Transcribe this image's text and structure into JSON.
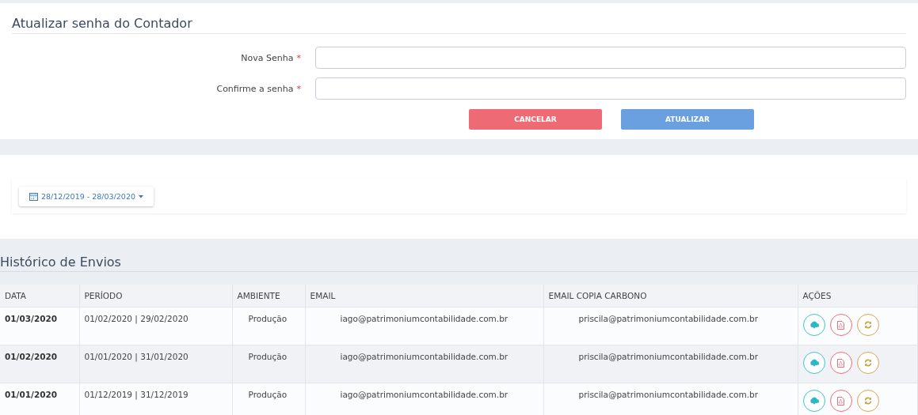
{
  "form": {
    "title": "Atualizar senha do Contador",
    "fields": [
      {
        "label": "Nova Senha",
        "required_mark": "*"
      },
      {
        "label": "Confirme a senha",
        "required_mark": "*"
      }
    ],
    "buttons": [
      {
        "label": "CANCELAR",
        "kind": "cancel"
      },
      {
        "label": "ATUALIZAR",
        "kind": "submit"
      }
    ]
  },
  "date_range": {
    "label": "28/12/2019 - 28/03/2020"
  },
  "history": {
    "title": "Histórico de Envios",
    "columns": [
      "DATA",
      "PERÍODO",
      "AMBIENTE",
      "EMAIL",
      "EMAIL COPIA CARBONO",
      "AÇÕES"
    ],
    "rows": [
      {
        "data": "01/03/2020",
        "periodo": "01/02/2020 | 29/02/2020",
        "ambiente": "Produção",
        "email": "iago@patrimoniumcontabilidade.com.br",
        "cc": "priscila@patrimoniumcontabilidade.com.br"
      },
      {
        "data": "01/02/2020",
        "periodo": "01/01/2020 | 31/01/2020",
        "ambiente": "Produção",
        "email": "iago@patrimoniumcontabilidade.com.br",
        "cc": "priscila@patrimoniumcontabilidade.com.br"
      },
      {
        "data": "01/01/2020",
        "periodo": "01/12/2019 | 31/12/2019",
        "ambiente": "Produção",
        "email": "iago@patrimoniumcontabilidade.com.br",
        "cc": "priscila@patrimoniumcontabilidade.com.br"
      }
    ]
  }
}
